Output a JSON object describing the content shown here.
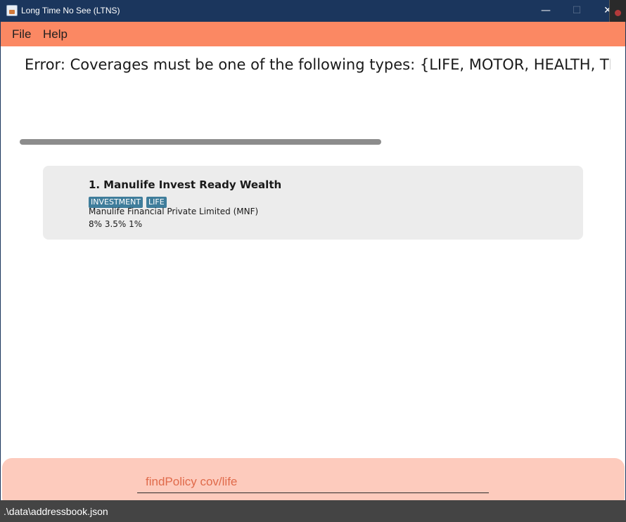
{
  "window": {
    "title": "Long Time No See (LTNS)",
    "minimize_glyph": "—",
    "maximize_glyph": "☐",
    "close_glyph": "✕"
  },
  "menu": {
    "file": "File",
    "help": "Help"
  },
  "result": {
    "text": "Error: Coverages must be one of the following types: {LIFE, MOTOR, HEALTH, TRAVEL, PROPERTY, INVESTMENT}"
  },
  "policies": [
    {
      "index": "1.",
      "title": "Manulife Invest Ready Wealth",
      "tags": [
        "INVESTMENT",
        "LIFE"
      ],
      "company": "Manulife Financial Private Limited (MNF)",
      "rates": "8% 3.5% 1%"
    }
  ],
  "command": {
    "value": "findPolicy cov/life"
  },
  "status": {
    "path": ".\\data\\addressbook.json"
  },
  "colors": {
    "title_bar": "#1b365d",
    "menu_bar": "#fb8863",
    "command_area": "#fdcbbd",
    "tag": "#3f7d9b",
    "status_bar": "#444444"
  }
}
